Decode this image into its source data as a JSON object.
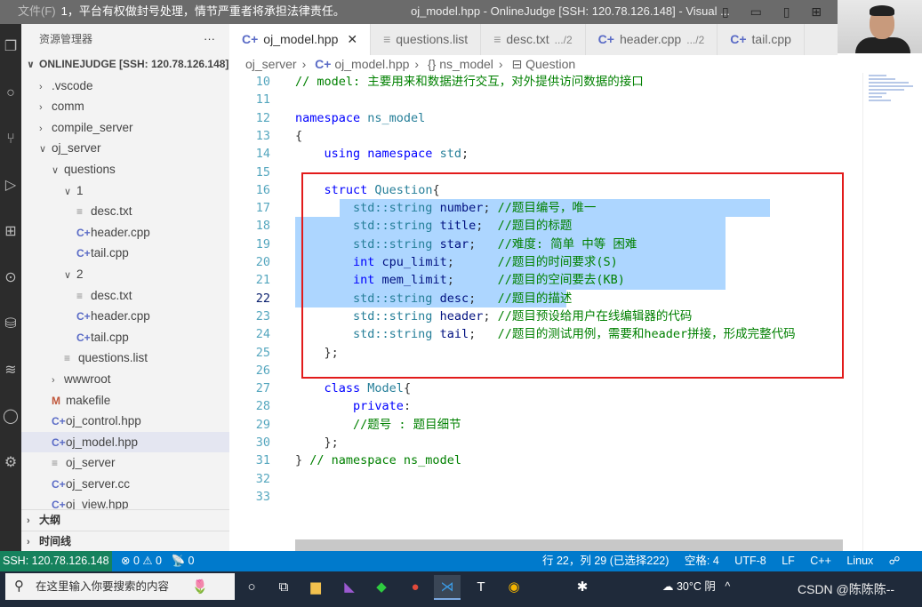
{
  "titlebar": {
    "menu": "文件(F)",
    "notice": "1，平台有权做封号处理，情节严重者将承担法律责任。",
    "window_title": "oj_model.hpp - OnlineJudge [SSH: 120.78.126.148] - Visual ...",
    "layout_icons": "▯ ▭ ▯ ⊞"
  },
  "sidebar": {
    "title": "资源管理器",
    "more": "···",
    "root": "ONLINEJUDGE [SSH: 120.78.126.148]",
    "items": [
      {
        "label": ".vscode",
        "type": "folder",
        "open": false,
        "depth": 1
      },
      {
        "label": "comm",
        "type": "folder",
        "open": false,
        "depth": 1
      },
      {
        "label": "compile_server",
        "type": "folder",
        "open": false,
        "depth": 1
      },
      {
        "label": "oj_server",
        "type": "folder",
        "open": true,
        "depth": 1
      },
      {
        "label": "questions",
        "type": "folder",
        "open": true,
        "depth": 2
      },
      {
        "label": "1",
        "type": "folder",
        "open": true,
        "depth": 3
      },
      {
        "label": "desc.txt",
        "type": "txt",
        "depth": 4
      },
      {
        "label": "header.cpp",
        "type": "cpp",
        "depth": 4
      },
      {
        "label": "tail.cpp",
        "type": "cpp",
        "depth": 4
      },
      {
        "label": "2",
        "type": "folder",
        "open": true,
        "depth": 3
      },
      {
        "label": "desc.txt",
        "type": "txt",
        "depth": 4
      },
      {
        "label": "header.cpp",
        "type": "cpp",
        "depth": 4
      },
      {
        "label": "tail.cpp",
        "type": "cpp",
        "depth": 4
      },
      {
        "label": "questions.list",
        "type": "txt",
        "depth": 3
      },
      {
        "label": "wwwroot",
        "type": "folder",
        "open": false,
        "depth": 2
      },
      {
        "label": "makefile",
        "type": "make",
        "depth": 2
      },
      {
        "label": "oj_control.hpp",
        "type": "cpp",
        "depth": 2
      },
      {
        "label": "oj_model.hpp",
        "type": "cpp",
        "depth": 2,
        "active": true
      },
      {
        "label": "oj_server",
        "type": "txt",
        "depth": 2
      },
      {
        "label": "oj_server.cc",
        "type": "cpp",
        "depth": 2
      },
      {
        "label": "oj_view.hpp",
        "type": "cpp",
        "depth": 2
      }
    ],
    "outline": "大纲",
    "timeline": "时间线"
  },
  "tabs": [
    {
      "label": "oj_model.hpp",
      "icon": "cpp",
      "active": true,
      "close": "✕"
    },
    {
      "label": "questions.list",
      "icon": "txt"
    },
    {
      "label": "desc.txt",
      "icon": "txt",
      "sub": ".../2"
    },
    {
      "label": "header.cpp",
      "icon": "cpp",
      "sub": ".../2"
    },
    {
      "label": "tail.cpp",
      "icon": "cpp"
    }
  ],
  "breadcrumb": [
    "oj_server",
    "oj_model.hpp",
    "ns_model",
    "Question"
  ],
  "editor": {
    "current_line": 22,
    "lines": [
      {
        "n": 10,
        "t": [
          [
            "cm",
            "// model: 主要用来和数据进行交互，对外提供访问数据的接口"
          ]
        ]
      },
      {
        "n": 11,
        "t": []
      },
      {
        "n": 12,
        "t": [
          [
            "kw",
            "namespace "
          ],
          [
            "ty",
            "ns_model"
          ]
        ]
      },
      {
        "n": 13,
        "t": [
          [
            "pl",
            "{"
          ]
        ]
      },
      {
        "n": 14,
        "t": [
          [
            "pl",
            "    "
          ],
          [
            "kw",
            "using namespace "
          ],
          [
            "ty",
            "std"
          ],
          [
            "pl",
            ";"
          ]
        ]
      },
      {
        "n": 15,
        "t": []
      },
      {
        "n": 16,
        "t": [
          [
            "pl",
            "    "
          ],
          [
            "kw",
            "struct "
          ],
          [
            "ty",
            "Question"
          ],
          [
            "pl",
            "{"
          ]
        ]
      },
      {
        "n": 17,
        "t": [
          [
            "pl",
            "        "
          ],
          [
            "ty",
            "std::string "
          ],
          [
            "id",
            "number"
          ],
          [
            "pl",
            "; "
          ],
          [
            "cm",
            "//题目编号，唯一"
          ]
        ]
      },
      {
        "n": 18,
        "t": [
          [
            "pl",
            "        "
          ],
          [
            "ty",
            "std::string "
          ],
          [
            "id",
            "title"
          ],
          [
            "pl",
            ";  "
          ],
          [
            "cm",
            "//题目的标题"
          ]
        ]
      },
      {
        "n": 19,
        "t": [
          [
            "pl",
            "        "
          ],
          [
            "ty",
            "std::string "
          ],
          [
            "id",
            "star"
          ],
          [
            "pl",
            ";   "
          ],
          [
            "cm",
            "//难度: 简单 中等 困难"
          ]
        ]
      },
      {
        "n": 20,
        "t": [
          [
            "pl",
            "        "
          ],
          [
            "kw",
            "int "
          ],
          [
            "id",
            "cpu_limit"
          ],
          [
            "pl",
            ";      "
          ],
          [
            "cm",
            "//题目的时间要求(S)"
          ]
        ]
      },
      {
        "n": 21,
        "t": [
          [
            "pl",
            "        "
          ],
          [
            "kw",
            "int "
          ],
          [
            "id",
            "mem_limit"
          ],
          [
            "pl",
            ";      "
          ],
          [
            "cm",
            "//题目的空间要去(KB)"
          ]
        ]
      },
      {
        "n": 22,
        "t": [
          [
            "pl",
            "        "
          ],
          [
            "ty",
            "std::string "
          ],
          [
            "id",
            "desc"
          ],
          [
            "pl",
            ";   "
          ],
          [
            "cm",
            "//题目的描述"
          ]
        ]
      },
      {
        "n": 23,
        "t": [
          [
            "pl",
            "        "
          ],
          [
            "ty",
            "std::string "
          ],
          [
            "id",
            "header"
          ],
          [
            "pl",
            "; "
          ],
          [
            "cm",
            "//题目预设给用户在线编辑器的代码"
          ]
        ]
      },
      {
        "n": 24,
        "t": [
          [
            "pl",
            "        "
          ],
          [
            "ty",
            "std::string "
          ],
          [
            "id",
            "tail"
          ],
          [
            "pl",
            ";   "
          ],
          [
            "cm",
            "//题目的测试用例，需要和header拼接，形成完整代码"
          ]
        ]
      },
      {
        "n": 25,
        "t": [
          [
            "pl",
            "    };"
          ]
        ]
      },
      {
        "n": 26,
        "t": []
      },
      {
        "n": 27,
        "t": [
          [
            "pl",
            "    "
          ],
          [
            "kw",
            "class "
          ],
          [
            "ty",
            "Model"
          ],
          [
            "pl",
            "{"
          ]
        ]
      },
      {
        "n": 28,
        "t": [
          [
            "pl",
            "        "
          ],
          [
            "kw",
            "private"
          ],
          [
            "pl",
            ":"
          ]
        ]
      },
      {
        "n": 29,
        "t": [
          [
            "pl",
            "        "
          ],
          [
            "cm",
            "//题号 : 题目细节"
          ]
        ]
      },
      {
        "n": 30,
        "t": [
          [
            "pl",
            "    };"
          ]
        ]
      },
      {
        "n": 31,
        "t": [
          [
            "pl",
            "} "
          ],
          [
            "cm",
            "// namespace ns_model"
          ]
        ]
      },
      {
        "n": 32,
        "t": []
      },
      {
        "n": 33,
        "t": []
      }
    ]
  },
  "status": {
    "remote": "SSH: 120.78.126.148",
    "problems": "⊗ 0 ⚠ 0",
    "ports": "📡 0",
    "position": "行 22，列 29 (已选择222)",
    "spaces": "空格: 4",
    "encoding": "UTF-8",
    "eol": "LF",
    "language": "C++",
    "platform": "Linux",
    "colors": {
      "bar": "#007acc",
      "remote": "#16825d"
    }
  },
  "taskbar": {
    "search_placeholder": "在这里输入你要搜索的内容",
    "weather": "30°C 阴",
    "watermark": "CSDN @陈陈陈--"
  }
}
